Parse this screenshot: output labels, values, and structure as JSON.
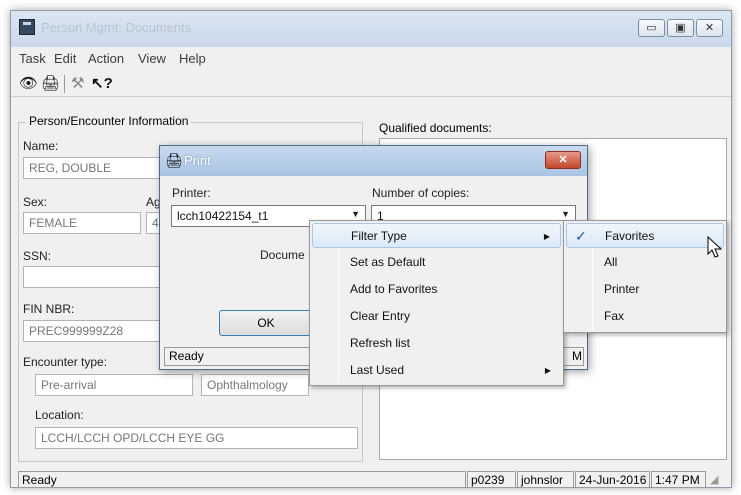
{
  "window": {
    "title": "Person Mgmt: Documents"
  },
  "window_buttons": {
    "minimize": "▭",
    "maximize": "▣",
    "close": "✕"
  },
  "menubar": [
    "Task",
    "Edit",
    "Action",
    "View",
    "Help"
  ],
  "toolbar": {
    "icons": [
      "view-icon",
      "print-icon",
      "hammer-icon",
      "help-pointer-icon"
    ]
  },
  "person_info": {
    "group_title": "Person/Encounter Information",
    "name_label": "Name:",
    "name_value": "REG, DOUBLE",
    "sex_label": "Sex:",
    "sex_value": "FEMALE",
    "age_label_partial": "Ag",
    "age_value_partial": "4",
    "ssn_label": "SSN:",
    "ssn_value": "",
    "fin_label": "FIN NBR:",
    "fin_value": "PREC999999Z28",
    "encounter_type_label": "Encounter type:",
    "encounter_type_value": "Pre-arrival",
    "encounter_specialty_value": "Ophthalmology",
    "location_label": "Location:",
    "location_value": "LCCH/LCCH OPD/LCCH EYE GG"
  },
  "qualified_documents_label": "Qualified documents:",
  "statusbar": {
    "status": "Ready",
    "code": "p0239",
    "user": "johnslor",
    "date": "24-Jun-2016",
    "time": "1:47 PM"
  },
  "print_dialog": {
    "title": "Print",
    "printer_label": "Printer:",
    "printer_value": "lcch10422154_t1",
    "copies_label": "Number of copies:",
    "copies_value": "1",
    "document_label_partial": "Docume",
    "ok_label": "OK",
    "status": "Ready",
    "status_time_partial": "M",
    "close_glyph": "✕"
  },
  "context_menu": {
    "items": [
      {
        "label": "Filter Type",
        "submenu": true
      },
      {
        "label": "Set as Default",
        "submenu": false
      },
      {
        "label": "Add to Favorites",
        "submenu": false
      },
      {
        "label": "Clear Entry",
        "submenu": false
      },
      {
        "label": "Refresh list",
        "submenu": false
      },
      {
        "label": "Last Used",
        "submenu": true
      }
    ],
    "submenu_arrow": "▶"
  },
  "filter_submenu": {
    "items": [
      "Favorites",
      "All",
      "Printer",
      "Fax"
    ],
    "checked": "Favorites",
    "check_glyph": "✓"
  },
  "colors": {
    "title_bg": "#c9d8ea",
    "highlight": "#dbe9f7",
    "close_red": "#c3462c"
  }
}
